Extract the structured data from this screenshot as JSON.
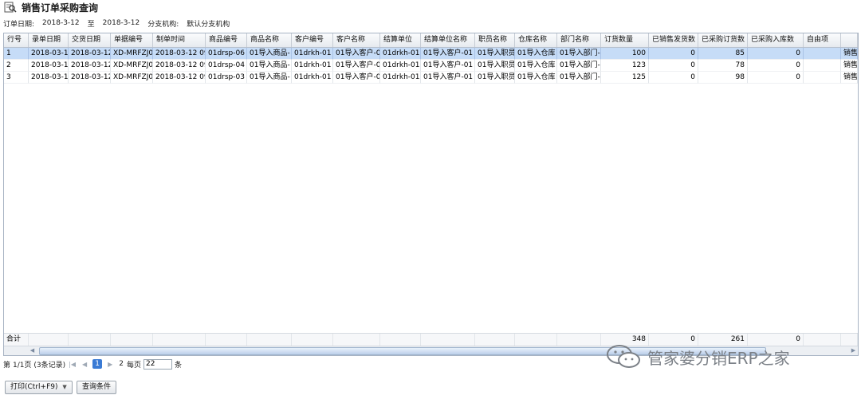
{
  "title": "销售订单采购查询",
  "filters": {
    "order_date_label": "订单日期:",
    "date_from": "2018-3-12",
    "to_label": "至",
    "date_to": "2018-3-12",
    "branch_label": "分支机构:",
    "branch_value": "默认分支机构"
  },
  "columns": [
    "行号",
    "录单日期",
    "交货日期",
    "单据编号",
    "制单时间",
    "商品编号",
    "商品名称",
    "客户编号",
    "客户名称",
    "结算单位",
    "结算单位名称",
    "职员名称",
    "仓库名称",
    "部门名称",
    "订货数量",
    "已销售发货数",
    "已采购订货数",
    "已采购入库数",
    "自由项",
    ""
  ],
  "rows": [
    [
      "1",
      "2018-03-12",
      "2018-03-12",
      "XD-MRFZJ0",
      "2018-03-12 09",
      "01drsp-06",
      "01导入商品-",
      "01drkh-01",
      "01导入客户-0",
      "01drkh-01",
      "01导入客户-01",
      "01导入职员",
      "01导入仓库",
      "01导入部门-",
      "100",
      "0",
      "85",
      "0",
      "",
      "销售"
    ],
    [
      "2",
      "2018-03-12",
      "2018-03-12",
      "XD-MRFZJ0",
      "2018-03-12 09",
      "01drsp-04",
      "01导入商品-",
      "01drkh-01",
      "01导入客户-0",
      "01drkh-01",
      "01导入客户-01",
      "01导入职员",
      "01导入仓库",
      "01导入部门-",
      "123",
      "0",
      "78",
      "0",
      "",
      "销售"
    ],
    [
      "3",
      "2018-03-12",
      "2018-03-12",
      "XD-MRFZJ0",
      "2018-03-12 09",
      "01drsp-03",
      "01导入商品-",
      "01drkh-01",
      "01导入客户-0",
      "01drkh-01",
      "01导入客户-01",
      "01导入职员",
      "01导入仓库",
      "01导入部门-",
      "125",
      "0",
      "98",
      "0",
      "",
      "销售"
    ]
  ],
  "totals": {
    "label": "合计",
    "order_qty": "348",
    "sold_shipped": "0",
    "purchased_ordered": "261",
    "purchased_stocked": "0"
  },
  "pager": {
    "prefix": "第",
    "page_info": "1/1页 (3条记录)",
    "current_page": "1",
    "next_page": "2",
    "per_page_label": "每页",
    "per_page_value": "22",
    "unit": "条"
  },
  "buttons": {
    "print": "打印(Ctrl+F9)",
    "query": "查询条件"
  },
  "watermark": "管家婆分销ERP之家",
  "colors": {
    "selected_row": "#c6dcf7",
    "current_page": "#3a7bd5"
  }
}
